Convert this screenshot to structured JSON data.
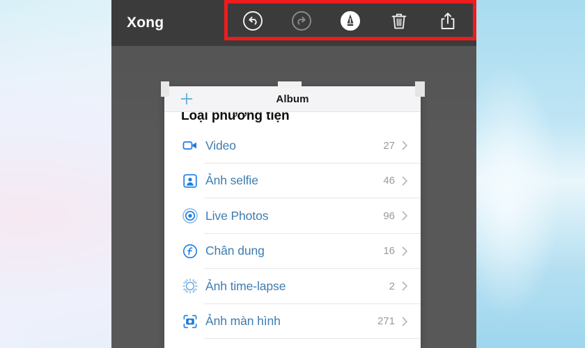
{
  "screen": {
    "backdrop_color": "#d9f0f8",
    "phone_bg": "#585858"
  },
  "toolbar": {
    "done_label": "Xong",
    "accent_highlight": "#ee1c1c",
    "bar_color": "#3b3b3b",
    "tools": [
      {
        "name": "undo-icon",
        "label": "Hoàn tác",
        "state": "enabled"
      },
      {
        "name": "redo-icon",
        "label": "Làm lại",
        "state": "disabled"
      },
      {
        "name": "markup-icon",
        "label": "Đánh dấu",
        "state": "enabled"
      },
      {
        "name": "trash-icon",
        "label": "Xóa",
        "state": "enabled"
      },
      {
        "name": "share-icon",
        "label": "Chia sẻ",
        "state": "enabled"
      }
    ]
  },
  "album_panel": {
    "add_icon": "plus-icon",
    "nav_title": "Album",
    "section_header": "Loại phương tiện",
    "link_color": "#3f7cb0",
    "rows": [
      {
        "icon": "video-camera-icon",
        "label": "Video",
        "count": "27",
        "chevron": "chevron-right-icon"
      },
      {
        "icon": "portrait-person-icon",
        "label": "Ảnh selfie",
        "count": "46",
        "chevron": "chevron-right-icon"
      },
      {
        "icon": "live-photo-icon",
        "label": "Live Photos",
        "count": "96",
        "chevron": "chevron-right-icon"
      },
      {
        "icon": "aperture-f-icon",
        "label": "Chân dung",
        "count": "16",
        "chevron": "chevron-right-icon"
      },
      {
        "icon": "time-lapse-icon",
        "label": "Ảnh time-lapse",
        "count": "2",
        "chevron": "chevron-right-icon"
      },
      {
        "icon": "screenshot-icon",
        "label": "Ảnh màn hình",
        "count": "271",
        "chevron": "chevron-right-icon"
      }
    ]
  }
}
